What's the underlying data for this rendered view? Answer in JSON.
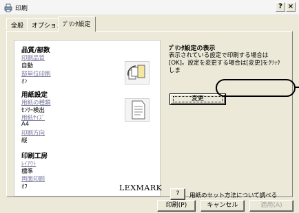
{
  "window": {
    "title": "印刷",
    "help_glyph": "?",
    "close_glyph": "×"
  },
  "tabs": [
    {
      "label": "全般"
    },
    {
      "label": "オプション"
    },
    {
      "label": "ﾌﾟﾘﾝﾀ設定"
    }
  ],
  "left": {
    "quality": {
      "heading": "品質/部数",
      "print_quality_link": "印刷品質",
      "print_quality_value": "自動",
      "unit_print_link": "部単位印刷",
      "unit_print_value": "ｵﾝ"
    },
    "paper": {
      "heading": "用紙設定",
      "paper_type_link": "用紙の種類",
      "paper_type_value": "ｾﾝｻｰ検出",
      "paper_size_link": "用紙ｻｲｽﾞ",
      "paper_size_value": "A4",
      "orientation_link": "印刷方向",
      "orientation_value": "縦"
    },
    "workshop": {
      "heading": "印刷工房",
      "layout_link": "ﾚｲｱｳﾄ",
      "layout_value": "標準",
      "duplex_link": "両面印刷",
      "duplex_value": "ｵﾌ"
    },
    "brand": "LEXMARK"
  },
  "right": {
    "heading": "ﾌﾟﾘﾝﾀ設定の表示",
    "description": "表示されている設定で印刷する場合は[OK]。設定を変更する場合は[変更]をｸﾘｯｸしま",
    "change_button": "変更"
  },
  "help": {
    "button": "?",
    "text": "用紙のセット方法について調べる"
  },
  "footer": {
    "print": "印刷(P)",
    "cancel": "キャンセル",
    "apply": "適用(A)"
  },
  "colors": {
    "face": "#ece9d8",
    "link": "#7b7b9e"
  }
}
